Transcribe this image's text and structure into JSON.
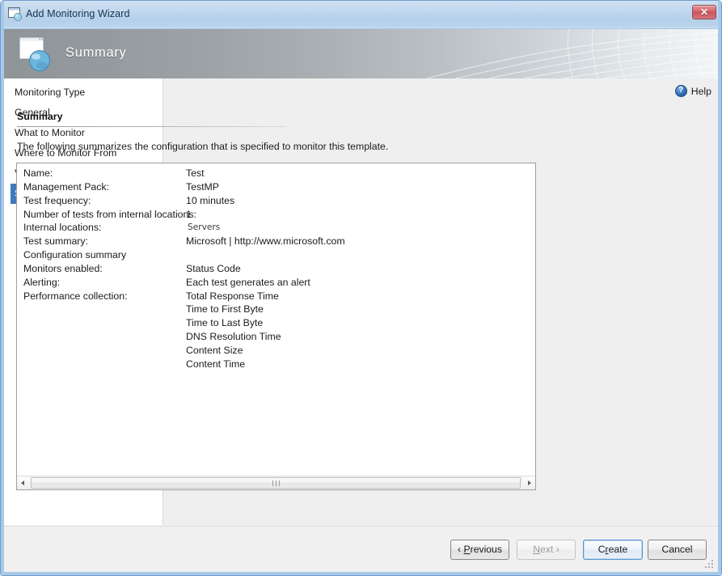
{
  "window": {
    "title": "Add Monitoring Wizard",
    "icon": "wizard-window-icon",
    "close_label": "✕"
  },
  "banner": {
    "title": "Summary",
    "icon": "wizard-globe-icon"
  },
  "sidebar": {
    "items": [
      {
        "label": "Monitoring Type",
        "selected": false
      },
      {
        "label": "General",
        "selected": false
      },
      {
        "label": "What to Monitor",
        "selected": false
      },
      {
        "label": "Where to Monitor From",
        "selected": false
      },
      {
        "label": "View and Validate Tests",
        "selected": false
      },
      {
        "label": "Summary",
        "selected": true
      }
    ],
    "selected_color": "#3d7bbd"
  },
  "help": {
    "label": "Help",
    "icon": "help-question-icon"
  },
  "main": {
    "heading": "Summary",
    "intro": "The following summarizes the configuration that is specified to monitor this template.",
    "rows": [
      {
        "label": "Name:",
        "value": "Test",
        "style": "normal"
      },
      {
        "label": "Management Pack:",
        "value": "TestMP",
        "style": "normal"
      },
      {
        "label": "Test frequency:",
        "value": "10 minutes",
        "style": "normal"
      },
      {
        "label": "Number of tests from internal locations:",
        "value": "1",
        "style": "normal"
      },
      {
        "label": "Internal locations:",
        "value": "Servers",
        "style": "alt"
      },
      {
        "label": "Test summary:",
        "value": "Microsoft | http://www.microsoft.com",
        "style": "normal"
      },
      {
        "label": "Configuration summary",
        "value": "",
        "style": "normal"
      },
      {
        "label": "Monitors enabled:",
        "value": "Status Code",
        "style": "normal"
      },
      {
        "label": "Alerting:",
        "value": "Each test generates an alert",
        "style": "normal"
      },
      {
        "label": "Performance collection:",
        "value": "Total Response Time",
        "style": "normal"
      },
      {
        "label": "",
        "value": "Time to First Byte",
        "style": "normal"
      },
      {
        "label": "",
        "value": "Time to Last Byte",
        "style": "normal"
      },
      {
        "label": "",
        "value": "DNS Resolution Time",
        "style": "normal"
      },
      {
        "label": "",
        "value": "Content Size",
        "style": "normal"
      },
      {
        "label": "",
        "value": "Content Time",
        "style": "normal"
      }
    ]
  },
  "scrollbar": {
    "left_arrow": "scroll-left-icon",
    "right_arrow": "scroll-right-icon"
  },
  "buttons": {
    "previous": {
      "prefix": "‹ ",
      "accel": "P",
      "rest": "revious",
      "disabled": false
    },
    "next": {
      "prefix": "",
      "accel": "N",
      "rest": "ext ›",
      "disabled": true
    },
    "create": {
      "prefix": "C",
      "accel": "r",
      "rest": "eate",
      "disabled": false,
      "default": true
    },
    "cancel": {
      "prefix": "",
      "accel": "",
      "rest": "Cancel",
      "disabled": false
    }
  }
}
